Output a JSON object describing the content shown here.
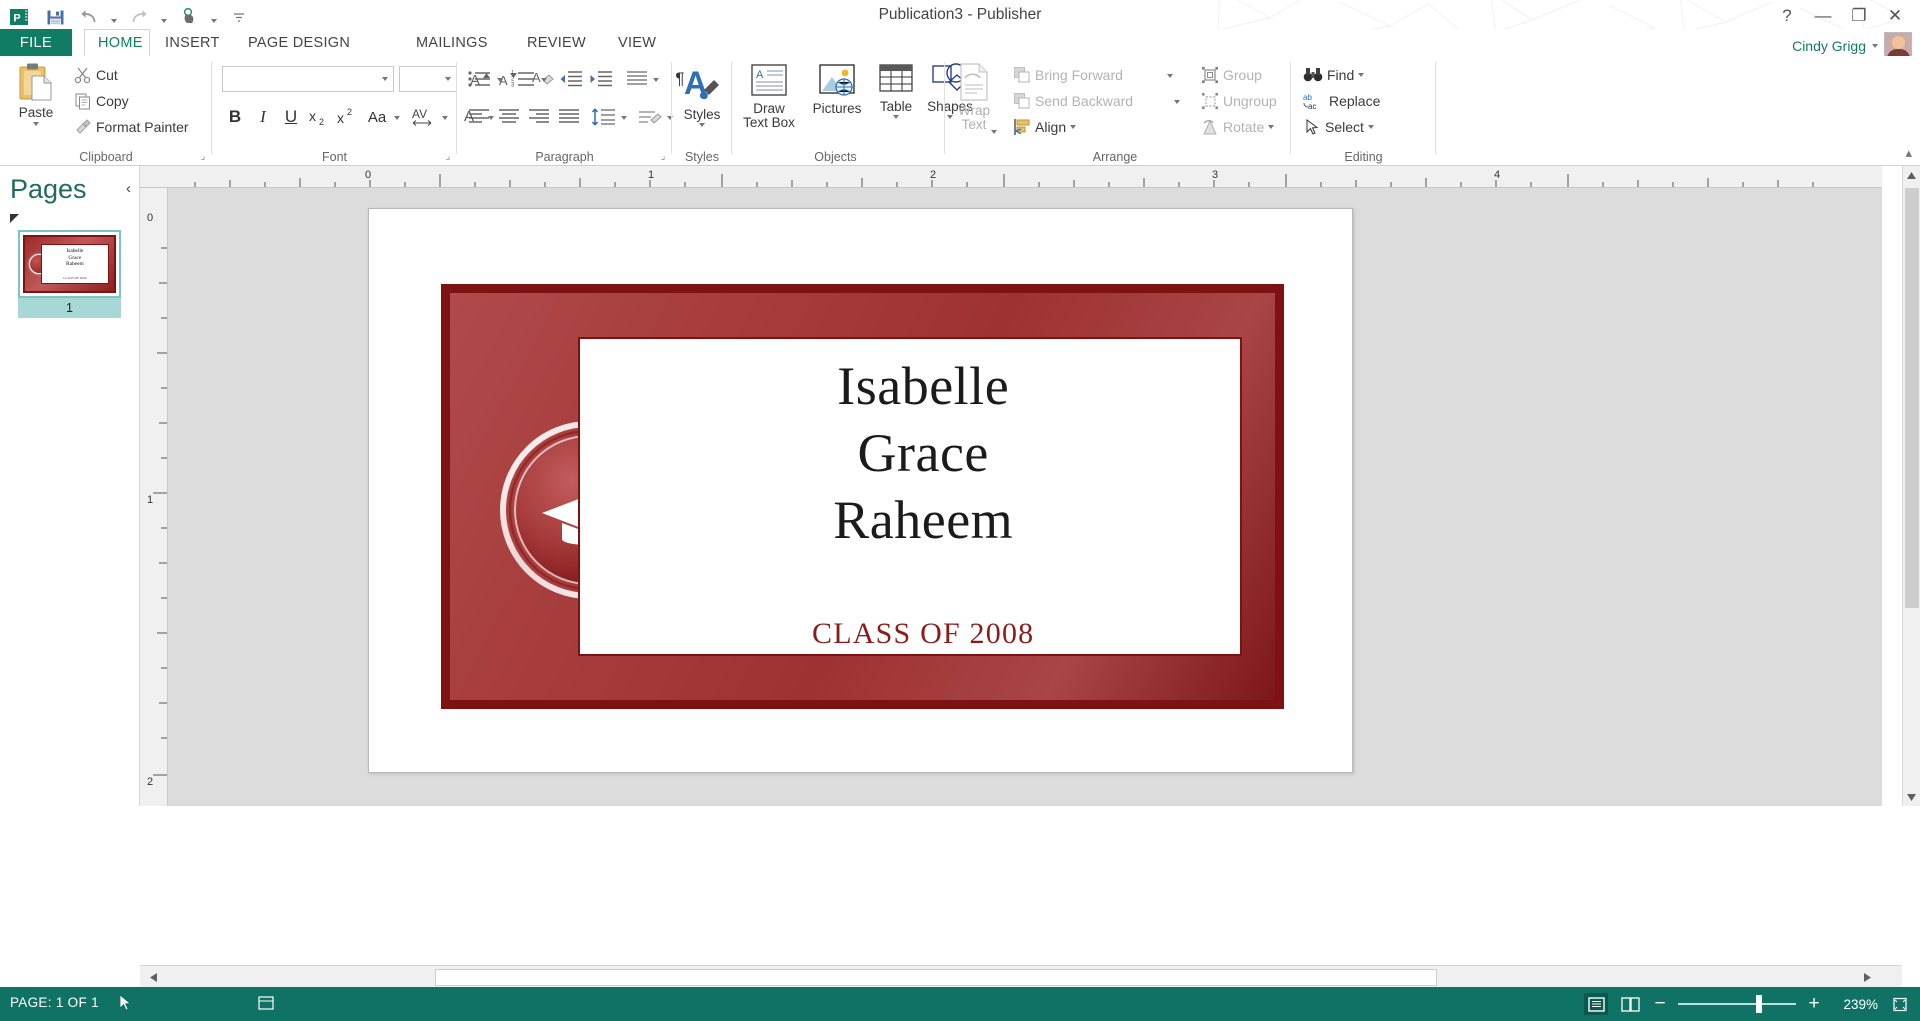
{
  "titlebar": {
    "title": "Publication3 - Publisher",
    "qat": [
      {
        "name": "publisher-logo-icon",
        "label": "Publisher"
      },
      {
        "name": "save-icon",
        "label": "Save"
      },
      {
        "name": "undo-icon",
        "label": "Undo"
      },
      {
        "name": "redo-icon",
        "label": "Redo"
      },
      {
        "name": "touch-mode-icon",
        "label": "Touch/Mouse Mode"
      },
      {
        "name": "customize-quick-access-icon",
        "label": "Customize Quick Access Toolbar"
      }
    ],
    "help": "?",
    "minimize": "—",
    "restore": "❐",
    "close": "✕"
  },
  "tabs": {
    "file": "FILE",
    "items": [
      {
        "label": "HOME",
        "active": true
      },
      {
        "label": "INSERT",
        "active": false
      },
      {
        "label": "PAGE DESIGN",
        "active": false
      },
      {
        "label": "MAILINGS",
        "active": false
      },
      {
        "label": "REVIEW",
        "active": false
      },
      {
        "label": "VIEW",
        "active": false
      }
    ],
    "user": "Cindy Grigg"
  },
  "ribbon": {
    "collapse_label": "▴",
    "groups": [
      {
        "name": "clipboard",
        "label": "Clipboard"
      },
      {
        "name": "font",
        "label": "Font"
      },
      {
        "name": "paragraph",
        "label": "Paragraph"
      },
      {
        "name": "styles",
        "label": "Styles"
      },
      {
        "name": "objects",
        "label": "Objects"
      },
      {
        "name": "arrange",
        "label": "Arrange"
      },
      {
        "name": "editing",
        "label": "Editing"
      }
    ],
    "clipboard": {
      "paste": "Paste",
      "cut": "Cut",
      "copy": "Copy",
      "format_painter": "Format Painter"
    },
    "font": {
      "font_name_value": "",
      "font_name_placeholder": "",
      "font_size_value": "",
      "grow_font": "A",
      "shrink_font": "A",
      "clear_formatting": "Clear All Formatting",
      "bold": "B",
      "italic": "I",
      "underline": "U",
      "subscript": "x",
      "superscript": "x",
      "change_case": "Aa",
      "character_spacing": "AV",
      "font_color": "A"
    },
    "paragraph": {
      "bullets": "Bullets",
      "numbering": "Numbering",
      "decrease_indent": "Decrease Indent",
      "increase_indent": "Increase Indent",
      "line_spacing_hz": "Spacing",
      "show_marks": "¶",
      "align_left": "Align Left",
      "align_center": "Center",
      "align_right": "Align Right",
      "justify": "Justify",
      "line_spacing": "Line Spacing",
      "text_effects": "Text Effects"
    },
    "styles": {
      "styles": "Styles"
    },
    "objects": {
      "draw_text_box": "Draw\nText Box",
      "draw_text_box_l1": "Draw",
      "draw_text_box_l2": "Text Box",
      "pictures": "Pictures",
      "table": "Table",
      "shapes": "Shapes"
    },
    "arrange": {
      "wrap_text_l1": "Wrap",
      "wrap_text_l2": "Text",
      "bring_forward": "Bring Forward",
      "send_backward": "Send Backward",
      "align": "Align",
      "group": "Group",
      "ungroup": "Ungroup",
      "rotate": "Rotate"
    },
    "editing": {
      "find": "Find",
      "replace": "Replace",
      "select": "Select"
    }
  },
  "pages_pane": {
    "title": "Pages",
    "collapse": "‹",
    "page_number": "1",
    "thumb": {
      "name_line1": "Isabelle",
      "name_line2": "Grace",
      "name_line3": "Raheem",
      "class": "CLASS OF 2008"
    }
  },
  "rulers": {
    "horizontal_labels": [
      "0",
      "1",
      "2",
      "3",
      "4"
    ],
    "vertical_labels": [
      "0",
      "1",
      "2"
    ]
  },
  "document": {
    "card": {
      "name_line1": "Isabelle",
      "name_line2": "Grace",
      "name_line3": "Raheem",
      "class_line": "CLASS OF 2008",
      "emblem": "graduation-cap-medallion"
    },
    "colors": {
      "card_border": "#7c1212",
      "card_fill_dark": "#7e1818",
      "card_fill_light": "#b04a4a",
      "class_text": "#8c1c1c",
      "name_text": "#1b1b1b"
    }
  },
  "statusbar": {
    "page_info": "PAGE: 1 OF 1",
    "zoom_value": "239%",
    "zoom_minus": "−",
    "zoom_plus": "+",
    "views": [
      {
        "name": "single-page-view",
        "active": true
      },
      {
        "name": "two-page-spread-view",
        "active": false
      }
    ]
  },
  "theme": {
    "accent_green": "#107c63",
    "status_bar": "#0f7265",
    "selection_teal": "#7fc3c0"
  }
}
